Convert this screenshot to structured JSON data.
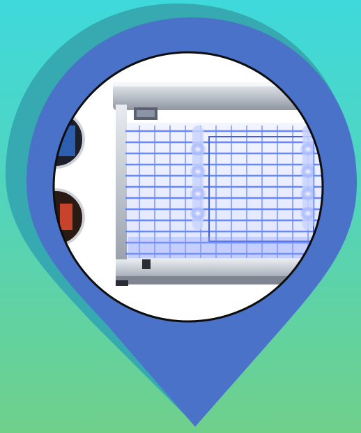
{
  "colors": {
    "background_top": "#3fd9dc",
    "background_bottom": "#6fd08a",
    "pin_shadow": "#36aab0",
    "pin_fill": "#4a72c8",
    "uv_glow": "#5b7cff",
    "frame_silver": "#c9ced6"
  },
  "icons": {
    "pin": "map-pin-icon",
    "product": "bug-zapper-lamp"
  }
}
